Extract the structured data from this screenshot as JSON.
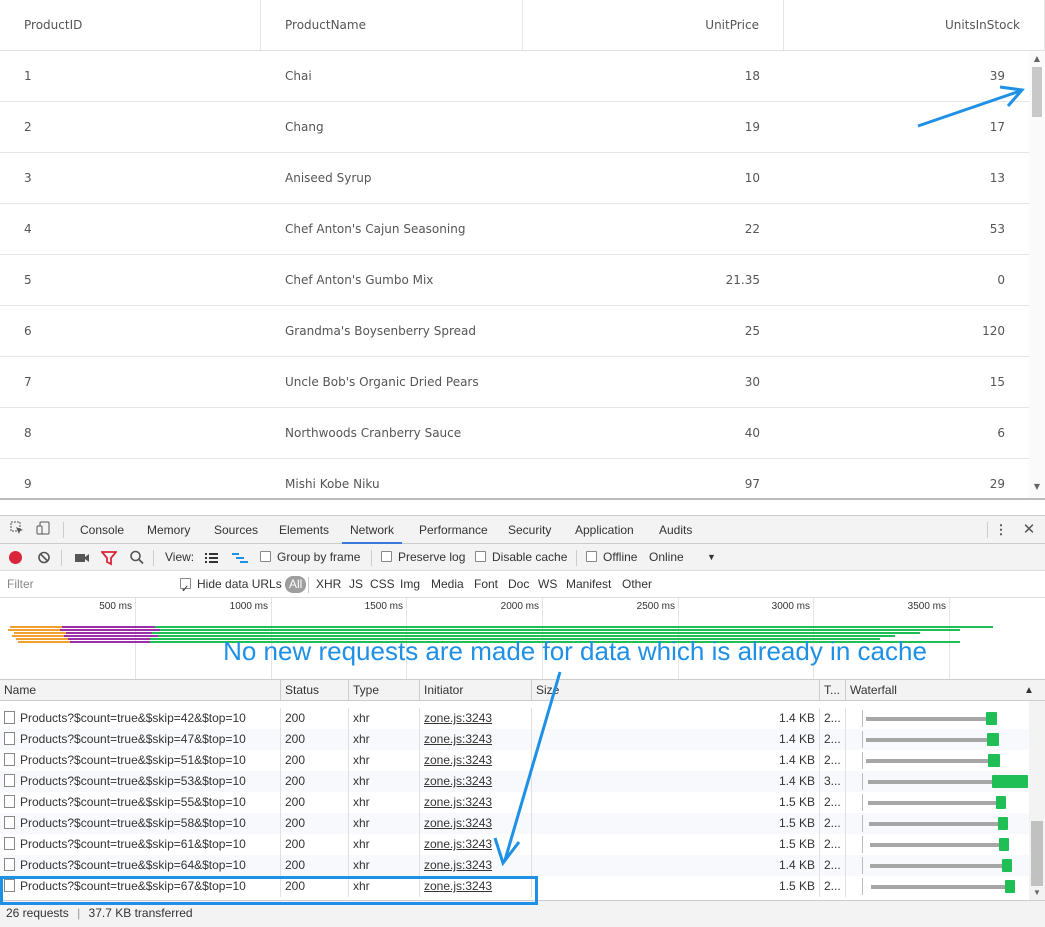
{
  "grid": {
    "columns": [
      "ProductID",
      "ProductName",
      "UnitPrice",
      "UnitsInStock"
    ],
    "rows": [
      [
        "1",
        "Chai",
        "18",
        "39"
      ],
      [
        "2",
        "Chang",
        "19",
        "17"
      ],
      [
        "3",
        "Aniseed Syrup",
        "10",
        "13"
      ],
      [
        "4",
        "Chef Anton's Cajun Seasoning",
        "22",
        "53"
      ],
      [
        "5",
        "Chef Anton's Gumbo Mix",
        "21.35",
        "0"
      ],
      [
        "6",
        "Grandma's Boysenberry Spread",
        "25",
        "120"
      ],
      [
        "7",
        "Uncle Bob's Organic Dried Pears",
        "30",
        "15"
      ],
      [
        "8",
        "Northwoods Cranberry Sauce",
        "40",
        "6"
      ],
      [
        "9",
        "Mishi Kobe Niku",
        "97",
        "29"
      ]
    ]
  },
  "devtools": {
    "tabs": [
      "Console",
      "Memory",
      "Sources",
      "Elements",
      "Network",
      "Performance",
      "Security",
      "Application",
      "Audits"
    ],
    "active_tab": "Network",
    "toolbar": {
      "view_label": "View:",
      "group_by_frame": "Group by frame",
      "preserve_log": "Preserve log",
      "disable_cache": "Disable cache",
      "offline": "Offline",
      "throttle": "Online"
    },
    "filter": {
      "placeholder": "Filter",
      "hide_data_urls": "Hide data URLs",
      "types": [
        "All",
        "XHR",
        "JS",
        "CSS",
        "Img",
        "Media",
        "Font",
        "Doc",
        "WS",
        "Manifest",
        "Other"
      ]
    },
    "overview_ticks": [
      "500 ms",
      "1000 ms",
      "1500 ms",
      "2000 ms",
      "2500 ms",
      "3000 ms",
      "3500 ms"
    ],
    "table_headers": [
      "Name",
      "Status",
      "Type",
      "Initiator",
      "Size",
      "T...",
      "Waterfall"
    ],
    "requests": [
      {
        "name": "Products?$count=true&$skip=42&$top=10",
        "status": "200",
        "type": "xhr",
        "initiator": "zone.js:3243",
        "size": "1.4 KB",
        "time": "2..."
      },
      {
        "name": "Products?$count=true&$skip=47&$top=10",
        "status": "200",
        "type": "xhr",
        "initiator": "zone.js:3243",
        "size": "1.4 KB",
        "time": "2..."
      },
      {
        "name": "Products?$count=true&$skip=51&$top=10",
        "status": "200",
        "type": "xhr",
        "initiator": "zone.js:3243",
        "size": "1.4 KB",
        "time": "2..."
      },
      {
        "name": "Products?$count=true&$skip=53&$top=10",
        "status": "200",
        "type": "xhr",
        "initiator": "zone.js:3243",
        "size": "1.4 KB",
        "time": "3..."
      },
      {
        "name": "Products?$count=true&$skip=55&$top=10",
        "status": "200",
        "type": "xhr",
        "initiator": "zone.js:3243",
        "size": "1.5 KB",
        "time": "2..."
      },
      {
        "name": "Products?$count=true&$skip=58&$top=10",
        "status": "200",
        "type": "xhr",
        "initiator": "zone.js:3243",
        "size": "1.5 KB",
        "time": "2..."
      },
      {
        "name": "Products?$count=true&$skip=61&$top=10",
        "status": "200",
        "type": "xhr",
        "initiator": "zone.js:3243",
        "size": "1.5 KB",
        "time": "2..."
      },
      {
        "name": "Products?$count=true&$skip=64&$top=10",
        "status": "200",
        "type": "xhr",
        "initiator": "zone.js:3243",
        "size": "1.4 KB",
        "time": "2..."
      },
      {
        "name": "Products?$count=true&$skip=67&$top=10",
        "status": "200",
        "type": "xhr",
        "initiator": "zone.js:3243",
        "size": "1.5 KB",
        "time": "2..."
      }
    ],
    "status_bar": {
      "requests": "26 requests",
      "sep": "|",
      "transferred": "37.7 KB transferred"
    }
  },
  "annotation": {
    "text": "No new requests are made for data which is already in cache",
    "color": "#1e90e6"
  }
}
